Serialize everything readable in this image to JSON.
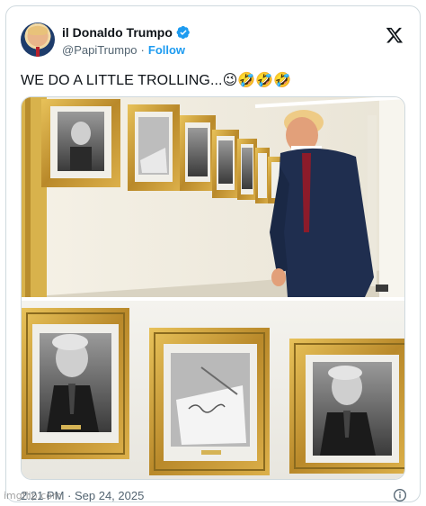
{
  "post": {
    "display_name": "il Donaldo Trumpo",
    "handle": "@PapiTrumpo",
    "separator": "·",
    "follow_label": "Follow",
    "text": "WE DO A LITTLE TROLLING...😉🤣🤣🤣",
    "timestamp": "2:21 PM · Sep 24, 2025"
  },
  "watermark": "imgflip.com",
  "icons": {
    "verified": "verified-badge-icon",
    "brand": "x-logo-icon",
    "info": "info-icon"
  },
  "colors": {
    "accent": "#1d9bf0",
    "text": "#0f1419",
    "muted": "#536471",
    "border": "#cfd9de",
    "frame_gold": "#c9a030"
  }
}
